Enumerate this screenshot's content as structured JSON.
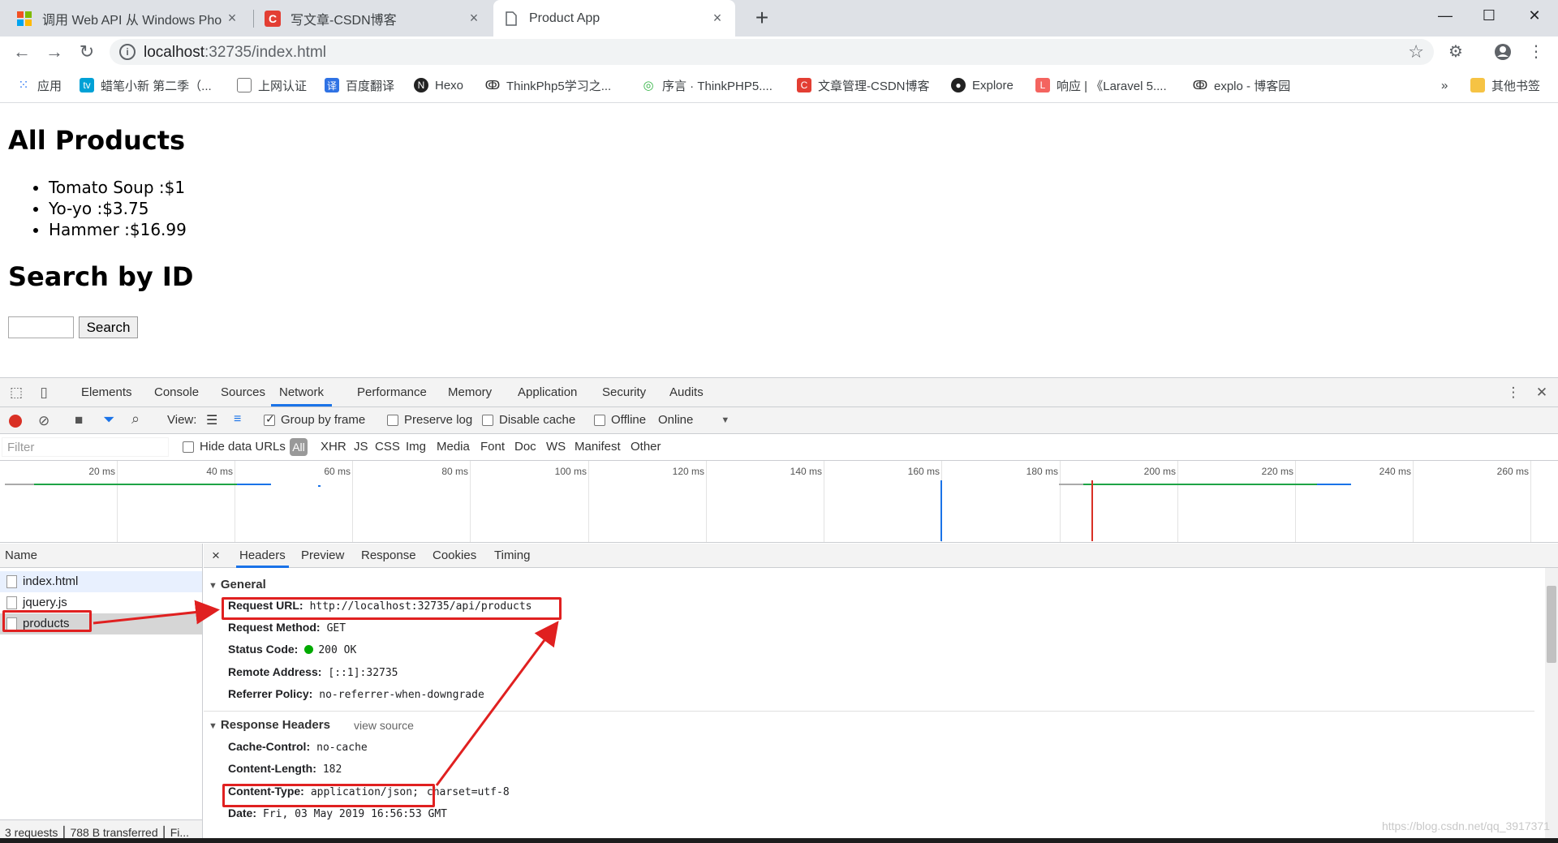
{
  "browser": {
    "tabs": [
      {
        "title": "调用 Web API 从 Windows Pho",
        "close": "×"
      },
      {
        "title": "写文章-CSDN博客",
        "close": "×"
      },
      {
        "title": "Product App",
        "close": "×"
      }
    ],
    "new_tab": "+",
    "window_controls": {
      "minimize": "—",
      "maximize": "☐",
      "close": "✕"
    },
    "address": {
      "host": "localhost",
      "rest": ":32735/index.html"
    },
    "bookmarks": [
      "应用",
      "蜡笔小新 第二季（...",
      "上网认证",
      "百度翻译",
      "Hexo",
      "ThinkPhp5学习之...",
      "序言 · ThinkPHP5....",
      "文章管理-CSDN博客",
      "Explore",
      "响应 | 《Laravel 5....",
      "explo - 博客园"
    ],
    "bookmarks_more": "»",
    "other_bookmarks": "其他书签"
  },
  "page": {
    "heading_products": "All Products",
    "products": [
      "Tomato Soup :$1",
      "Yo-yo :$3.75",
      "Hammer :$16.99"
    ],
    "heading_search": "Search by ID",
    "search_button": "Search"
  },
  "devtools": {
    "tabs": [
      "Elements",
      "Console",
      "Sources",
      "Network",
      "Performance",
      "Memory",
      "Application",
      "Security",
      "Audits"
    ],
    "active_tab": "Network",
    "toolbar": {
      "view_label": "View:",
      "group_by_frame": "Group by frame",
      "preserve_log": "Preserve log",
      "disable_cache": "Disable cache",
      "offline": "Offline",
      "throttle": "Online"
    },
    "filter": {
      "placeholder": "Filter",
      "hide_data_urls": "Hide data URLs",
      "all": "All",
      "types": [
        "XHR",
        "JS",
        "CSS",
        "Img",
        "Media",
        "Font",
        "Doc",
        "WS",
        "Manifest",
        "Other"
      ]
    },
    "timeline_ticks": [
      "20 ms",
      "40 ms",
      "60 ms",
      "80 ms",
      "100 ms",
      "120 ms",
      "140 ms",
      "160 ms",
      "180 ms",
      "200 ms",
      "220 ms",
      "240 ms",
      "260 ms"
    ],
    "name_header": "Name",
    "requests": [
      "index.html",
      "jquery.js",
      "products"
    ],
    "selected_request": "products",
    "status": "3 requests ⎮ 788 B transferred ⎮ Fi...",
    "detail_tabs": [
      "Headers",
      "Preview",
      "Response",
      "Cookies",
      "Timing"
    ],
    "detail_close": "×",
    "general_title": "General",
    "general": [
      {
        "key": "Request URL:",
        "value": "http://localhost:32735/api/products"
      },
      {
        "key": "Request Method:",
        "value": "GET"
      },
      {
        "key": "Status Code:",
        "value": "200 OK"
      },
      {
        "key": "Remote Address:",
        "value": "[::1]:32735"
      },
      {
        "key": "Referrer Policy:",
        "value": "no-referrer-when-downgrade"
      }
    ],
    "response_headers_title": "Response Headers",
    "view_source": "view source",
    "response_headers": [
      {
        "key": "Cache-Control:",
        "value": "no-cache"
      },
      {
        "key": "Content-Length:",
        "value": "182"
      },
      {
        "key": "Content-Type:",
        "value": "application/json;",
        "value2": "charset=utf-8"
      },
      {
        "key": "Date:",
        "value": "Fri, 03 May 2019 16:56:53 GMT"
      }
    ]
  },
  "watermark": "https://blog.csdn.net/qq_3917371",
  "colors": {
    "accent": "#1a73e8",
    "annotation_red": "#e02020",
    "status_ok": "#00aa00",
    "record_red": "#d93025"
  }
}
